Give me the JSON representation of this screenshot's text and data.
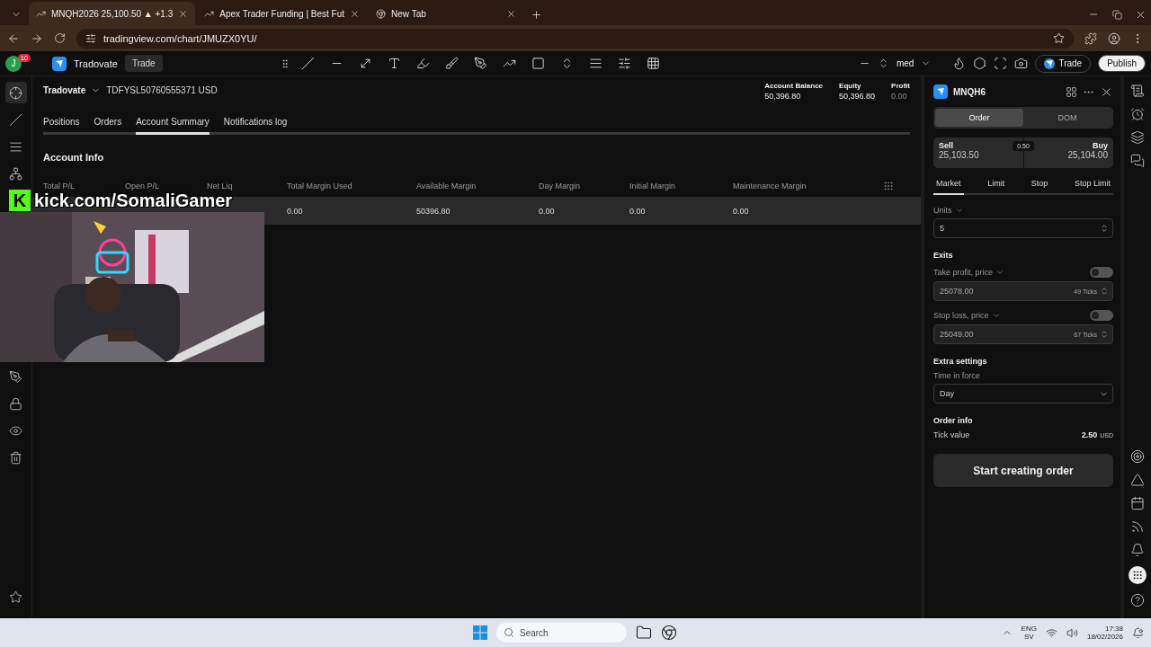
{
  "browser": {
    "tabs": [
      {
        "title": "MNQH2026 25,100.50 ▲ +1.3",
        "selected": true
      },
      {
        "title": "Apex Trader Funding | Best Fut",
        "selected": false
      },
      {
        "title": "New Tab",
        "selected": false
      }
    ],
    "url": "tradingview.com/chart/JMUZX0YU/"
  },
  "app_bar": {
    "avatar": "J",
    "badge": "10",
    "broker": "Tradovate",
    "trade_button": "Trade",
    "layout_name": "med",
    "trade_pill": "Trade",
    "publish": "Publish"
  },
  "account": {
    "broker": "Tradovate",
    "account_id": "TDFYSL50760555371 USD",
    "stats": [
      {
        "label": "Account Balance",
        "value": "50,396.80",
        "muted": false
      },
      {
        "label": "Equity",
        "value": "50,396.80",
        "muted": false
      },
      {
        "label": "Profit",
        "value": "0.00",
        "muted": true
      }
    ]
  },
  "tabs": [
    {
      "label": "Positions",
      "selected": false
    },
    {
      "label": "Orders",
      "selected": false
    },
    {
      "label": "Account Summary",
      "selected": true
    },
    {
      "label": "Notifications log",
      "selected": false
    }
  ],
  "section_title": "Account Info",
  "table": {
    "columns": [
      {
        "header": "Total P/L"
      },
      {
        "header": "Open P/L"
      },
      {
        "header": "Net Liq"
      },
      {
        "header": "Total Margin Used",
        "value": "0.00"
      },
      {
        "header": "Available Margin",
        "value": "50396.80"
      },
      {
        "header": "Day Margin",
        "value": "0.00"
      },
      {
        "header": "Initial Margin",
        "value": "0.00"
      },
      {
        "header": "Maintenance Margin",
        "value": "0.00"
      }
    ]
  },
  "overlay": {
    "logo": "K",
    "text": "kick.com/SomaliGamer"
  },
  "order_panel": {
    "symbol": "MNQH6",
    "modes": [
      {
        "label": "Order",
        "selected": true
      },
      {
        "label": "DOM",
        "selected": false
      }
    ],
    "sell": {
      "label": "Sell",
      "price": "25,103.50"
    },
    "spread": "0.50",
    "buy": {
      "label": "Buy",
      "price": "25,104.00"
    },
    "order_types": [
      {
        "label": "Market",
        "selected": true
      },
      {
        "label": "Limit",
        "selected": false
      },
      {
        "label": "Stop",
        "selected": false
      },
      {
        "label": "Stop Limit",
        "selected": false
      }
    ],
    "units_label": "Units",
    "units": "5",
    "exits_title": "Exits",
    "exits": [
      {
        "label": "Take profit, price",
        "on": false,
        "value": "25078.00",
        "ticks": "49 Ticks"
      },
      {
        "label": "Stop loss, price",
        "on": false,
        "value": "25049.00",
        "ticks": "67 Ticks"
      }
    ],
    "extra_title": "Extra settings",
    "tif_label": "Time in force",
    "tif": "Day",
    "info_title": "Order info",
    "tick_label": "Tick value",
    "tick_value": "2.50",
    "tick_unit": "USD",
    "submit": "Start creating order"
  },
  "taskbar": {
    "search": "Search",
    "lang": "ENG",
    "layout": "SV",
    "time": "17:38",
    "date": "18/02/2026"
  }
}
